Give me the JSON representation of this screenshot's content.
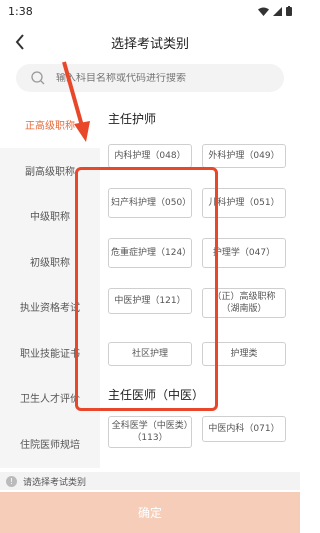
{
  "status": {
    "time": "1:38"
  },
  "header": {
    "title": "选择考试类别"
  },
  "search": {
    "placeholder": "输入科目名称或代码进行搜索"
  },
  "sidebar": {
    "items": [
      {
        "label": "正高级职称",
        "active": true
      },
      {
        "label": "副高级职称",
        "active": false
      },
      {
        "label": "中级职称",
        "active": false
      },
      {
        "label": "初级职称",
        "active": false
      },
      {
        "label": "执业资格考试",
        "active": false
      },
      {
        "label": "职业技能证书",
        "active": false
      },
      {
        "label": "卫生人才评价",
        "active": false
      },
      {
        "label": "住院医师规培",
        "active": false
      }
    ]
  },
  "content": {
    "sections": [
      {
        "title": "主任护师",
        "chips": [
          "内科护理（048）",
          "外科护理（049）",
          "妇产科护理（050）",
          "儿科护理（051）",
          "危重症护理（124）",
          "护理学（047）",
          "中医护理（121）",
          "（正）高级职称（湖南版）",
          "社区护理",
          "护理类"
        ]
      },
      {
        "title": "主任医师（中医）",
        "chips": [
          "全科医学（中医类）（113）",
          "中医内科（071）"
        ]
      }
    ]
  },
  "hint": {
    "text": "请选择考试类别"
  },
  "confirm": {
    "label": "确定"
  },
  "colors": {
    "accent": "#e86a3a",
    "highlight": "#e8472a",
    "confirm_bg": "#f6cdb8"
  }
}
